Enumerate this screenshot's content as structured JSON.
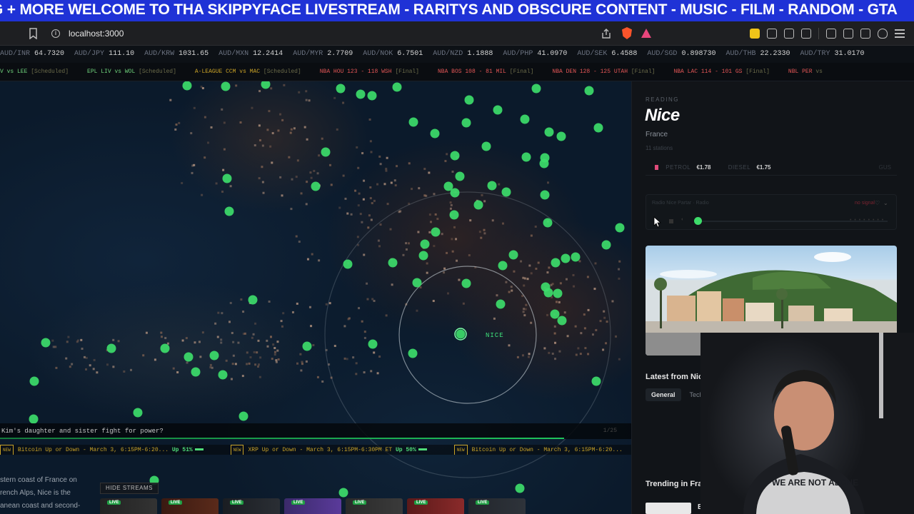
{
  "marquee": {
    "text": "G + MORE  WELCOME TO THA SKIPPYFACE LIVESTREAM  - RARITYS AND OBSCURE CONTENT - MUSIC - FILM - RANDOM - GTA"
  },
  "browser": {
    "url": "localhost:3000"
  },
  "fx_ticker": [
    {
      "pair": "AUD/INR",
      "value": "64.7320"
    },
    {
      "pair": "AUD/JPY",
      "value": "111.10"
    },
    {
      "pair": "AUD/KRW",
      "value": "1031.65"
    },
    {
      "pair": "AUD/MXN",
      "value": "12.2414"
    },
    {
      "pair": "AUD/MYR",
      "value": "2.7709"
    },
    {
      "pair": "AUD/NOK",
      "value": "6.7501"
    },
    {
      "pair": "AUD/NZD",
      "value": "1.1888"
    },
    {
      "pair": "AUD/PHP",
      "value": "41.0970"
    },
    {
      "pair": "AUD/SEK",
      "value": "6.4588"
    },
    {
      "pair": "AUD/SGD",
      "value": "0.898730"
    },
    {
      "pair": "AUD/THB",
      "value": "22.2330"
    },
    {
      "pair": "AUD/TRY",
      "value": "31.0170"
    }
  ],
  "sports_ticker": [
    {
      "text": "V vs LEE",
      "status": "[Scheduled]",
      "tone": "green"
    },
    {
      "text": "EPL LIV vs WOL",
      "status": "[Scheduled]",
      "tone": "green"
    },
    {
      "text": "A-LEAGUE CCM vs MAC",
      "status": "[Scheduled]",
      "tone": "gold"
    },
    {
      "text": "NBA HOU 123 - 118 WSH",
      "status": "[Final]",
      "tone": "red"
    },
    {
      "text": "NBA BOS 108 - 81 MIL",
      "status": "[Final]",
      "tone": "red"
    },
    {
      "text": "NBA DEN 128 - 125 UTAH",
      "status": "[Final]",
      "tone": "red"
    },
    {
      "text": "NBA LAC 114 - 101 GS",
      "status": "[Final]",
      "tone": "red"
    },
    {
      "text": "NBL PER",
      "status": "vs",
      "tone": "red"
    }
  ],
  "map": {
    "selected_label": "NICE"
  },
  "headline": {
    "text": "Kim's daughter and sister fight for power?",
    "count": "1/25"
  },
  "markets": [
    {
      "tag": "NEW",
      "text": "Bitcoin Up or Down - March 3, 6:15PM-6:20...",
      "pct": "Up 51%"
    },
    {
      "tag": "NEW",
      "text": "XRP Up or Down - March 3, 6:15PM-6:30PM ET",
      "pct": "Up 50%"
    },
    {
      "tag": "NEW",
      "text": "Bitcoin Up or Down - March 3, 6:15PM-6:20...",
      "pct": ""
    }
  ],
  "wiki_snippet": [
    "stern coast of France on",
    "rench Alps, Nice is the",
    "anean coast and second-"
  ],
  "streams": {
    "hide_label": "HIDE STREAMS",
    "live_label": "LIVE"
  },
  "panel": {
    "reading_label": "READING",
    "city": "Nice",
    "country": "France",
    "stations": "11 stations",
    "fuel": {
      "petrol_label": "PETROL",
      "petrol": "€1.78",
      "diesel_label": "DIESEL",
      "diesel": "€1.75",
      "more": "GUS"
    },
    "radio": {
      "name": "Radio Nice Partar · Radio",
      "status": "no signal"
    },
    "latest_title": "Latest from Nic",
    "tabs": [
      "General",
      "Tech"
    ],
    "trending_title": "Trending in Fra",
    "trending_first": "B"
  },
  "colors": {
    "accent": "#3ddc6a",
    "marquee_bg": "#1f32d6",
    "panel_bg": "#111418"
  }
}
